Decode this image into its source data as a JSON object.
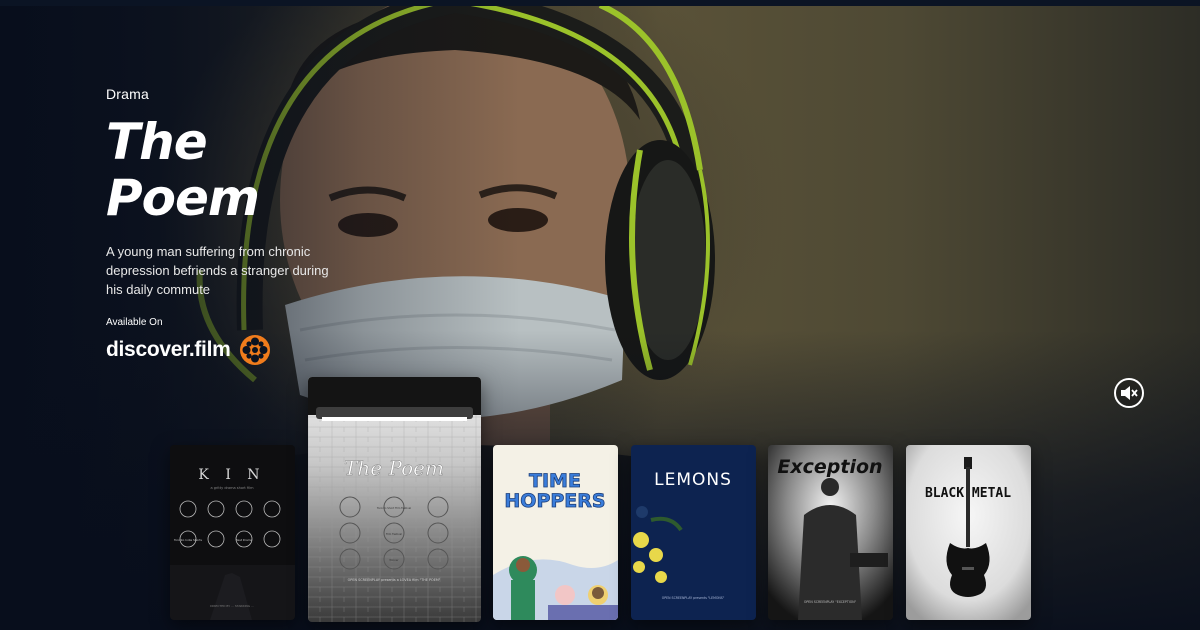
{
  "hero": {
    "genre": "Drama",
    "title": "The Poem",
    "synopsis": "A young man suffering from chronic depression befriends a stranger during his daily commute",
    "available_label": "Available On",
    "provider": "discover.film",
    "provider_icon": "film-reel-icon",
    "mute_icon": "speaker-muted-icon"
  },
  "colors": {
    "accent_orange": "#f07c1c",
    "background": "#0a1220",
    "headphone_green": "#9bc22a"
  },
  "posters": [
    {
      "name": "kin",
      "title": "K I N",
      "tagline": "a gritty drama short film",
      "laurels": [
        "Toronto Indie Shorts",
        "Official Selection",
        "Winner",
        "Best Drama",
        "Semi-Finalist",
        "Official Selection"
      ],
      "credits": "DIRECTED BY ... STARRING ..."
    },
    {
      "name": "the-poem",
      "title": "The Poem",
      "laurels": [
        "Official Selection",
        "Toronto Short Film Festival",
        "Official Selection",
        "Official Selection",
        "Film Festival",
        "Semi-Finalist",
        "Semi-Finalist",
        "Winner",
        "Semi-Finalist"
      ],
      "credits": "OPEN SCREENPLAY presents a LOVEA film \"THE POEM\""
    },
    {
      "name": "time-hoppers",
      "title_line1": "TIME",
      "title_line2": "HOPPERS"
    },
    {
      "name": "lemons",
      "title": "LEMONS",
      "credits": "OPEN SCREENPLAY presents \"LEMONS\""
    },
    {
      "name": "exception",
      "title": "Exception",
      "credits": "OPEN SCREENPLAY \"EXCEPTION\""
    },
    {
      "name": "black-metal",
      "title": "BLACK METAL"
    }
  ]
}
